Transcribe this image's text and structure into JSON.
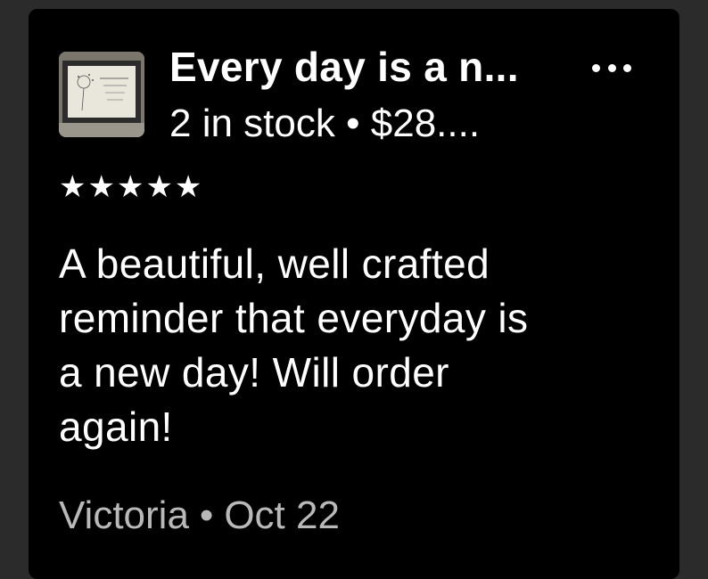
{
  "listing": {
    "title": "Every day is a n...",
    "stock": "2 in stock",
    "separator": "•",
    "price": "$28....",
    "thumbnail_icon": "framed-print-thumbnail"
  },
  "menu": {
    "icon": "more-options-icon"
  },
  "review": {
    "rating": 5,
    "stars": "★★★★★",
    "text": "A beautiful, well crafted\nreminder that everyday is\na new day!  Will order\nagain!",
    "author": "Victoria",
    "separator": "•",
    "date": "Oct 22"
  },
  "colors": {
    "card_background": "#000000",
    "page_background": "#2b2b2b",
    "primary_text": "#ffffff",
    "secondary_text": "#b9b9b9"
  }
}
